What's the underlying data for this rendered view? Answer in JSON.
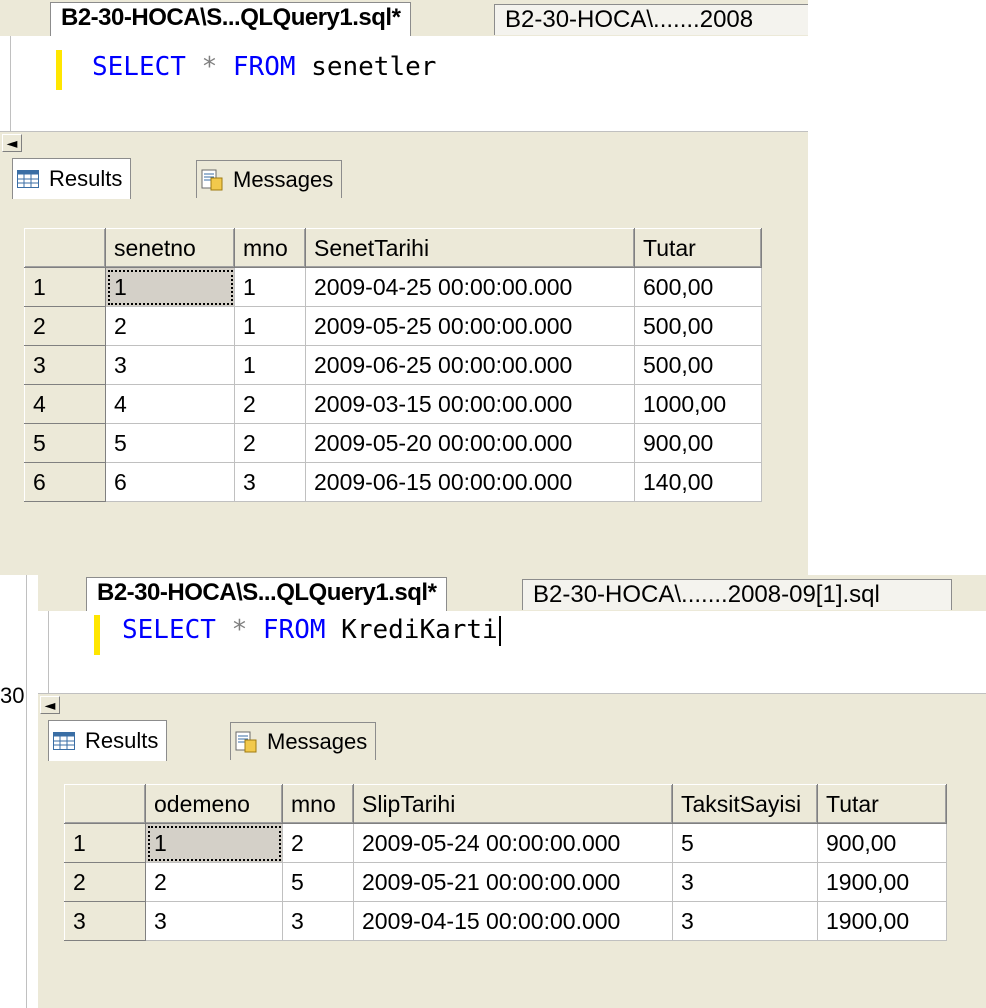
{
  "panel1": {
    "tabs": [
      {
        "label": "B2-30-HOCA\\S...QLQuery1.sql*",
        "active": true
      },
      {
        "label": "B2-30-HOCA\\.......2008",
        "active": false
      }
    ],
    "query": {
      "keyword_select": "SELECT",
      "star": "*",
      "keyword_from": "FROM",
      "table": "senetler"
    },
    "scroll_arrow": "◄",
    "result_tabs": {
      "results": "Results",
      "messages": "Messages"
    },
    "grid": {
      "columns": [
        "senetno",
        "mno",
        "SenetTarihi",
        "Tutar"
      ],
      "rows": [
        {
          "num": "1",
          "cells": [
            "1",
            "1",
            "2009-04-25 00:00:00.000",
            "600,00"
          ]
        },
        {
          "num": "2",
          "cells": [
            "2",
            "1",
            "2009-05-25 00:00:00.000",
            "500,00"
          ]
        },
        {
          "num": "3",
          "cells": [
            "3",
            "1",
            "2009-06-25 00:00:00.000",
            "500,00"
          ]
        },
        {
          "num": "4",
          "cells": [
            "4",
            "2",
            "2009-03-15 00:00:00.000",
            "1000,00"
          ]
        },
        {
          "num": "5",
          "cells": [
            "5",
            "2",
            "2009-05-20 00:00:00.000",
            "900,00"
          ]
        },
        {
          "num": "6",
          "cells": [
            "6",
            "3",
            "2009-06-15 00:00:00.000",
            "140,00"
          ]
        }
      ]
    }
  },
  "panel2": {
    "tabs": [
      {
        "label": "B2-30-HOCA\\S...QLQuery1.sql*",
        "active": true
      },
      {
        "label": "B2-30-HOCA\\.......2008-09[1].sql",
        "active": false
      }
    ],
    "left_fragment": "30",
    "query": {
      "keyword_select": "SELECT",
      "star": "*",
      "keyword_from": "FROM",
      "table": "KrediKarti"
    },
    "scroll_arrow": "◄",
    "result_tabs": {
      "results": "Results",
      "messages": "Messages"
    },
    "grid": {
      "columns": [
        "odemeno",
        "mno",
        "SlipTarihi",
        "TaksitSayisi",
        "Tutar"
      ],
      "rows": [
        {
          "num": "1",
          "cells": [
            "1",
            "2",
            "2009-05-24 00:00:00.000",
            "5",
            "900,00"
          ]
        },
        {
          "num": "2",
          "cells": [
            "2",
            "5",
            "2009-05-21 00:00:00.000",
            "3",
            "1900,00"
          ]
        },
        {
          "num": "3",
          "cells": [
            "3",
            "3",
            "2009-04-15 00:00:00.000",
            "3",
            "1900,00"
          ]
        }
      ]
    }
  },
  "colors": {
    "keyword": "#0000ff",
    "operator": "#808080",
    "changebar": "#ffe600",
    "chrome": "#ece9d8"
  }
}
